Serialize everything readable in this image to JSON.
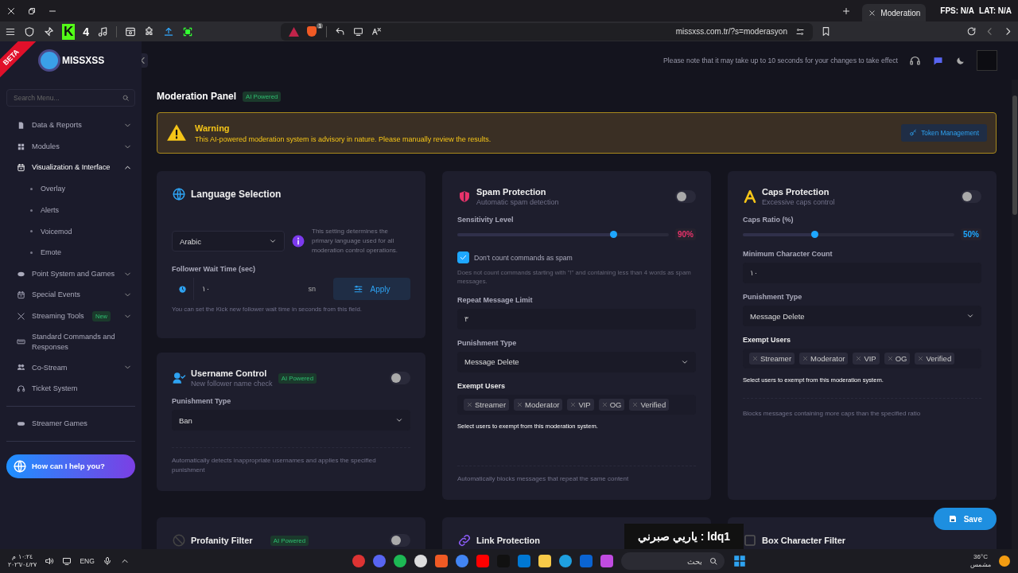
{
  "browser": {
    "tab_title": "Moderation",
    "overlay_fps": "FPS: N/A",
    "overlay_lat": "LAT: N/A",
    "extension_letter": "K",
    "extension_count": "4",
    "shield_badge": "1",
    "url": "missxss.com.tr/?s=moderasyon"
  },
  "header": {
    "ribbon": "BETA",
    "brand": "MISSXSS",
    "notice": "Please note that it may take up to 10 seconds for your changes to take effect"
  },
  "sidebar": {
    "search_placeholder": "Search Menu...",
    "items": [
      {
        "label": "Data & Reports",
        "expanded": false,
        "selected": false
      },
      {
        "label": "Modules",
        "expanded": false,
        "selected": false
      },
      {
        "label": "Visualization & Interface",
        "expanded": true,
        "selected": true,
        "children": [
          {
            "label": "Overlay"
          },
          {
            "label": "Alerts"
          },
          {
            "label": "Voicemod"
          },
          {
            "label": "Emote"
          }
        ]
      },
      {
        "label": "Point System and Games",
        "expanded": false,
        "selected": false
      },
      {
        "label": "Special Events",
        "expanded": false,
        "selected": false
      },
      {
        "label": "Streaming Tools",
        "badge": "New",
        "expanded": false,
        "selected": false
      },
      {
        "label": "Standard Commands and Responses",
        "selected": false
      },
      {
        "label": "Co-Stream",
        "expanded": false,
        "selected": false
      },
      {
        "label": "Ticket System",
        "selected": false
      }
    ],
    "footer_items": [
      {
        "label": "Streamer Games"
      }
    ],
    "help_button": "How can I help you?"
  },
  "panel": {
    "title": "Moderation Panel",
    "badge": "AI Powered",
    "warning": {
      "title": "Warning",
      "text": "This AI-powered moderation system is advisory in nature. Please manually review the results.",
      "button": "Token Management"
    }
  },
  "columns": [
    [
      {
        "title": "Language Selection",
        "fields": [
          {
            "kind": "select-info",
            "value": "Arabic",
            "info": "This setting determines the primary language used for all moderation control operations."
          },
          {
            "kind": "wait-time",
            "label": "Follower Wait Time (sec)",
            "value": "١٠",
            "unit": "sn",
            "button": "Apply",
            "hint": "You can set the Kick new follower wait time in seconds from this field."
          }
        ]
      },
      {
        "title": "Username Control",
        "subtitle": "New follower name check",
        "badge": "AI Powered",
        "toggle_on": false,
        "fields": [
          {
            "kind": "select",
            "label": "Punishment Type",
            "value": "Ban"
          }
        ],
        "description": "Automatically detects inappropriate usernames and applies the specified punishment"
      }
    ],
    [
      {
        "title": "Spam Protection",
        "subtitle": "Automatic spam detection",
        "toggle_on": false,
        "fields": [
          {
            "kind": "slider",
            "label": "Sensitivity Level",
            "level": 0.74,
            "reading": "90%",
            "color": "#e8336b"
          },
          {
            "kind": "checkbox",
            "label": "Don't count commands as spam",
            "checked": true,
            "hint": "Does not count commands starting with \"!\" and containing less than 4 words as spam messages."
          },
          {
            "kind": "number",
            "label": "Repeat Message Limit",
            "value": "٣"
          },
          {
            "kind": "select",
            "label": "Punishment Type",
            "value": "Message Delete"
          },
          {
            "kind": "tags",
            "label": "Exempt Users",
            "tags": [
              "Streamer",
              "Moderator",
              "VIP",
              "OG",
              "Verified"
            ],
            "hint": "Select users to exempt from this moderation system."
          }
        ],
        "description": "Automatically blocks messages that repeat the same content"
      }
    ],
    [
      {
        "title": "Caps Protection",
        "subtitle": "Excessive caps control",
        "toggle_on": false,
        "fields": [
          {
            "kind": "slider",
            "label": "Caps Ratio (%)",
            "level": 0.34,
            "reading": "50%",
            "color": "#1ea7ff"
          },
          {
            "kind": "number",
            "label": "Minimum Character Count",
            "value": "١٠"
          },
          {
            "kind": "select",
            "label": "Punishment Type",
            "value": "Message Delete"
          },
          {
            "kind": "tags",
            "label": "Exempt Users",
            "tags": [
              "Streamer",
              "Moderator",
              "VIP",
              "OG",
              "Verified"
            ],
            "hint": "Select users to exempt from this moderation system."
          }
        ],
        "description": "Blocks messages containing more caps than the specified ratio"
      }
    ]
  ],
  "lower_cards": [
    {
      "title": "Profanity Filter",
      "badge": "AI Powered",
      "toggle_on": false
    },
    {
      "title": "Link Protection"
    },
    {
      "title": "Box Character Filter"
    }
  ],
  "save_button": "Save",
  "stream_overlay": "ldq1 : ياريي صبرني",
  "taskbar": {
    "time": "١٠:٢٤ م",
    "date": "٢٠٢٦/٠٤/٢٧",
    "language": "ENG",
    "search_placeholder": "بحث",
    "temperature": "36°C",
    "weather": "مشمس"
  }
}
